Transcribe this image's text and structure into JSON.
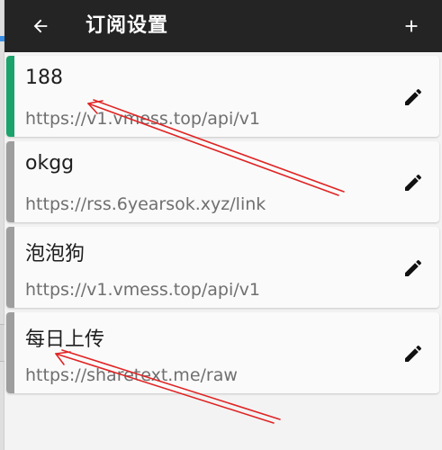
{
  "app_bar": {
    "title": "订阅设置",
    "back_icon": "arrow-left-icon",
    "add_icon": "plus-icon",
    "background": "#242424"
  },
  "subscriptions": [
    {
      "name": "188",
      "url": "https://v1.vmess.top/api/v1",
      "stripe_color": "#1aa36a",
      "active": true
    },
    {
      "name": "okgg",
      "url": "https://rss.6yearsok.xyz/link",
      "stripe_color": "#9e9e9e",
      "active": false
    },
    {
      "name": "泡泡狗",
      "url": "https://v1.vmess.top/api/v1",
      "stripe_color": "#9e9e9e",
      "active": false
    },
    {
      "name": "每日上传",
      "url": "https://sharetext.me/raw",
      "stripe_color": "#9e9e9e",
      "active": false
    }
  ],
  "edit_icon": "pencil-icon",
  "annotation_color": "#e02424"
}
